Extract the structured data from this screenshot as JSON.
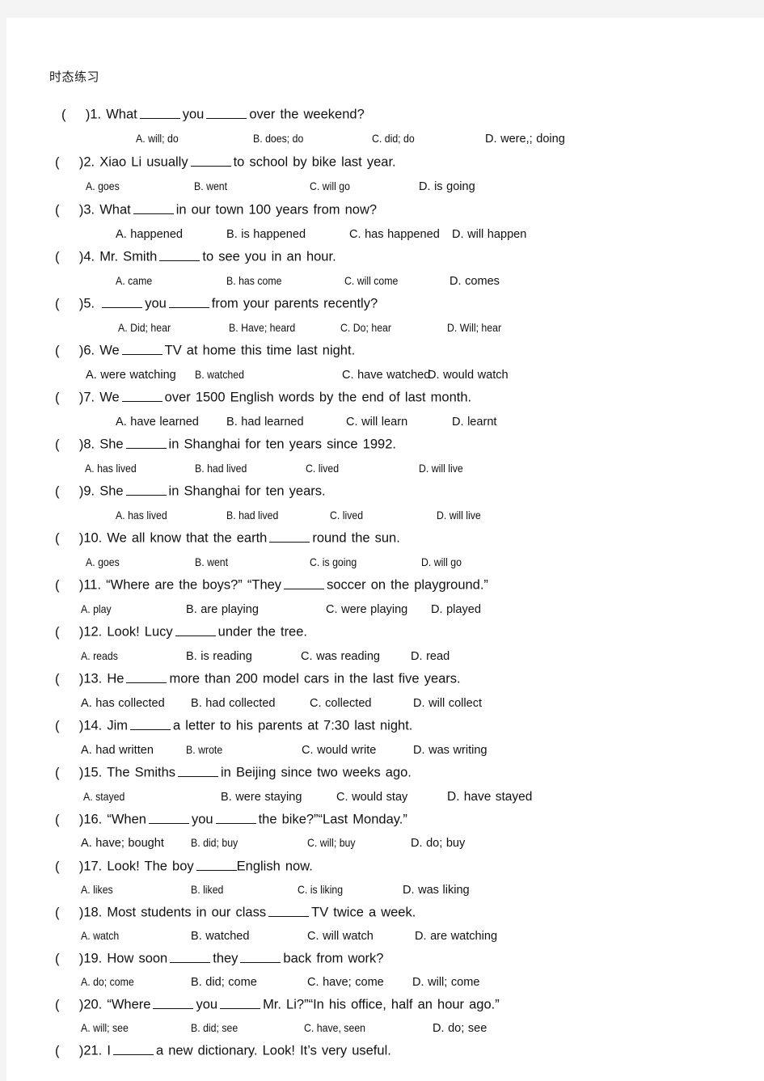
{
  "document": {
    "title": "时态练习",
    "page_bg": "#ffffff",
    "canvas_bg": "#f4f4f4",
    "text_color": "#111111"
  },
  "questions": [
    {
      "number": "1",
      "stem_before": "What",
      "stem_parts": [
        "What",
        "you",
        "over the weekend?"
      ],
      "text": "What _____ you _____ over the weekend?",
      "options": [
        "A. will; do",
        "B. does; do",
        "C. did; do",
        "D. were,; doing"
      ]
    },
    {
      "number": "2",
      "text": "Xiao Li usually _____ to school by bike last year.",
      "options": [
        "A. goes",
        "B. went",
        "C. will go",
        "D. is going"
      ]
    },
    {
      "number": "3",
      "text": "What _____ in our town 100 years from now?",
      "options": [
        "A. happened",
        "B. is happened",
        "C. has happened",
        "D. will happen"
      ]
    },
    {
      "number": "4",
      "text": "Mr. Smith _____ to see you in an hour.",
      "options": [
        "A. came",
        "B. has come",
        "C. will come",
        "D. comes"
      ]
    },
    {
      "number": "5",
      "text": "_____ you _____ from your parents recently?",
      "options": [
        "A. Did; hear",
        "B. Have; heard",
        "C. Do; hear",
        "D. Will; hear"
      ]
    },
    {
      "number": "6",
      "text": "We _____ TV at home this time last night.",
      "options": [
        "A. were watching",
        "B. watched",
        "C. have watched",
        "D. would watch"
      ]
    },
    {
      "number": "7",
      "text": "We _____ over 1500 English words by the end of last month.",
      "options": [
        "A. have learned",
        "B. had learned",
        "C. will learn",
        "D. learnt"
      ]
    },
    {
      "number": "8",
      "text": "She _____ in Shanghai for ten years since 1992.",
      "options": [
        "A. has lived",
        "B. had lived",
        "C. lived",
        "D. will live"
      ]
    },
    {
      "number": "9",
      "text": "She _____ in Shanghai for ten years.",
      "options": [
        "A. has lived",
        "B. had lived",
        "C. lived",
        "D. will live"
      ]
    },
    {
      "number": "10",
      "text": "We all know that the earth _____ round the sun.",
      "options": [
        "A. goes",
        "B. went",
        "C. is going",
        "D. will go"
      ]
    },
    {
      "number": "11",
      "text": "“Where are the boys?” “They _____ soccer on the playground.”",
      "options": [
        "A. play",
        "B. are playing",
        "C. were playing",
        "D. played"
      ]
    },
    {
      "number": "12",
      "text": "Look! Lucy _____ under the tree.",
      "options": [
        "A. reads",
        "B. is reading",
        "C. was reading",
        "D. read"
      ]
    },
    {
      "number": "13",
      "text": "He _____ more than 200 model cars in the last five years.",
      "options": [
        "A. has collected",
        "B. had collected",
        "C. collected",
        "D. will collect"
      ]
    },
    {
      "number": "14",
      "text": "Jim _____ a letter to his parents at 7:30 last night.",
      "options": [
        "A. had written",
        "B. wrote",
        "C. would write",
        "D. was writing"
      ]
    },
    {
      "number": "15",
      "text": "The Smiths _____ in Beijing since two weeks ago.",
      "options": [
        "A. stayed",
        "B. were staying",
        "C. would stay",
        "D. have stayed"
      ]
    },
    {
      "number": "16",
      "text": "“When _____ you _____ the bike?”“Last Monday.”",
      "options": [
        "A. have; bought",
        "B. did; buy",
        "C. will; buy",
        "D. do; buy"
      ]
    },
    {
      "number": "17",
      "text": "Look! The boy _____English now.",
      "options": [
        "A. likes",
        "B. liked",
        "C. is liking",
        "D. was liking"
      ]
    },
    {
      "number": "18",
      "text": "Most students in our class _____ TV twice a week.",
      "options": [
        "A. watch",
        "B. watched",
        "C. will watch",
        "D. are watching"
      ]
    },
    {
      "number": "19",
      "text": "How soon _____ they _____ back from work?",
      "options": [
        "A. do; come",
        "B. did; come",
        "C. have; come",
        "D. will; come"
      ]
    },
    {
      "number": "20",
      "text": "“Where _____ you _____ Mr. Li?”“In his office, half an hour ago.”",
      "options": [
        "A. will; see",
        "B. did; see",
        "C. have, seen",
        "D. do; see"
      ]
    },
    {
      "number": "21",
      "text": "I _____ a new dictionary. Look! It’s very useful.",
      "options": []
    }
  ],
  "fragments": {
    "open_paren": "(",
    "close_paren": ")",
    "dot": "."
  }
}
